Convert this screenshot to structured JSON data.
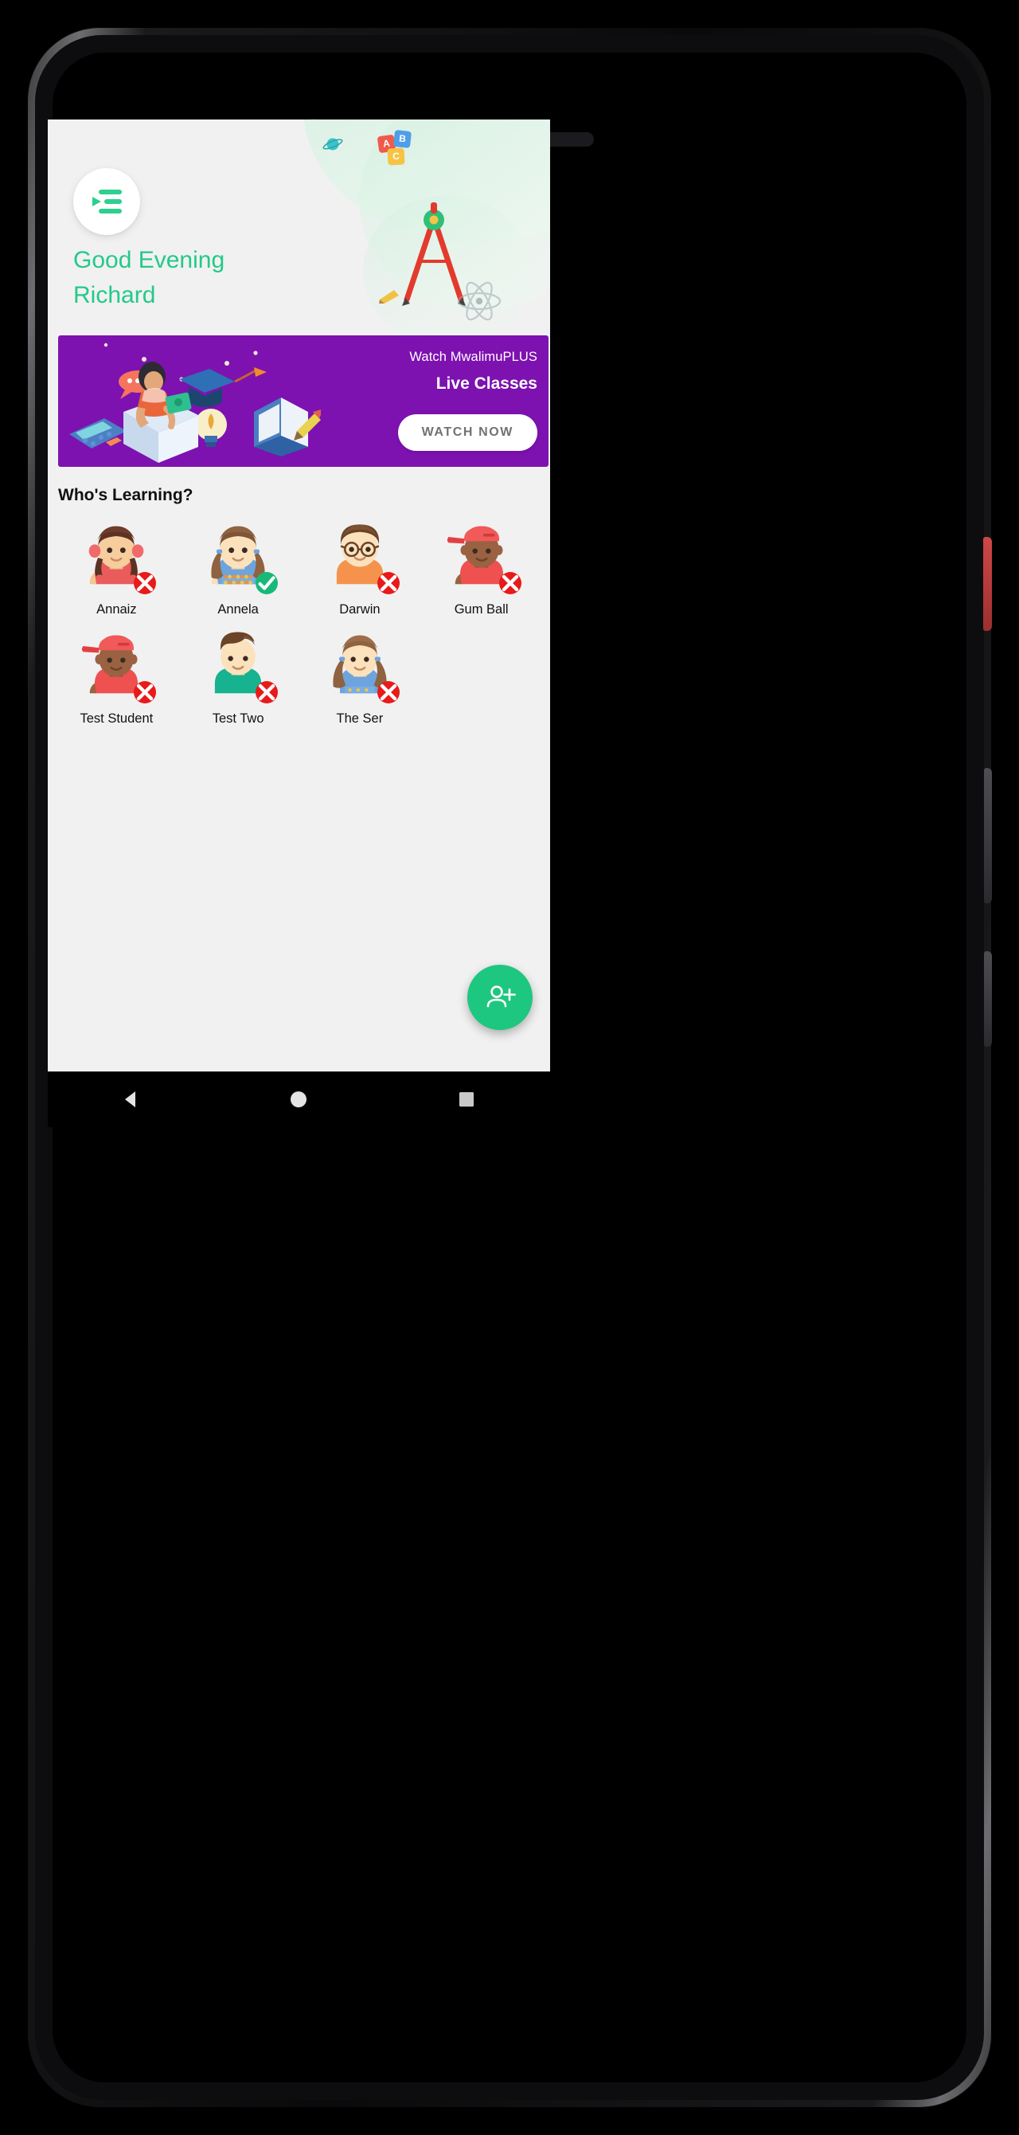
{
  "app": {
    "greeting_line1": "Good Evening",
    "greeting_line2": "Richard",
    "greeting_color": "#24c98a",
    "background_color": "#f1f1f1"
  },
  "header": {
    "menu_icon": "menu-open-icon"
  },
  "promo": {
    "subtitle": "Watch MwalimuPLUS",
    "title": "Live Classes",
    "button_label": "WATCH NOW",
    "background_color": "#7d12b0",
    "button_text_color": "#727272"
  },
  "students_section": {
    "title": "Who's Learning?",
    "students": [
      {
        "name": "Annaiz",
        "status": "inactive",
        "badge_icon": "close-icon",
        "avatar": "girl-pigtails-red"
      },
      {
        "name": "Annela",
        "status": "active",
        "badge_icon": "check-icon",
        "avatar": "girl-pigtails-blue"
      },
      {
        "name": "Darwin",
        "status": "inactive",
        "badge_icon": "close-icon",
        "avatar": "boy-glasses-orange"
      },
      {
        "name": "Gum Ball",
        "status": "inactive",
        "badge_icon": "close-icon",
        "avatar": "boy-cap-red"
      },
      {
        "name": "Test Student",
        "status": "inactive",
        "badge_icon": "close-icon",
        "avatar": "boy-cap-red"
      },
      {
        "name": "Test Two",
        "status": "inactive",
        "badge_icon": "close-icon",
        "avatar": "boy-teal"
      },
      {
        "name": "The Ser",
        "status": "inactive",
        "badge_icon": "close-icon",
        "avatar": "girl-ponytail-blue"
      }
    ]
  },
  "fab": {
    "icon": "person-add-icon",
    "color": "#1ec77f"
  },
  "decor": {
    "abc_blocks": [
      "A",
      "B",
      "C"
    ]
  },
  "navbar": {
    "back": "back-triangle-icon",
    "home": "home-circle-icon",
    "recents": "recents-square-icon"
  }
}
